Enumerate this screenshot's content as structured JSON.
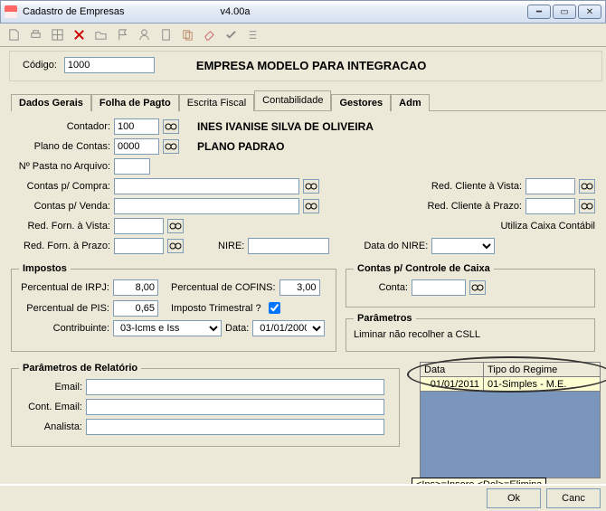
{
  "window": {
    "title": "Cadastro de Empresas",
    "version": "v4.00a"
  },
  "codigo": {
    "label": "Código:",
    "value": "1000"
  },
  "empresa_nome": "EMPRESA MODELO PARA INTEGRACAO",
  "tabs": {
    "t0": "Dados Gerais",
    "t1": "Folha de Pagto",
    "t2": "Escrita Fiscal",
    "t3": "Contabilidade",
    "t4": "Gestores",
    "t5": "Adm"
  },
  "contador": {
    "label": "Contador:",
    "value": "100",
    "display": "INES IVANISE SILVA DE OLIVEIRA"
  },
  "plano": {
    "label": "Plano de Contas:",
    "value": "0000",
    "display": "PLANO PADRAO"
  },
  "pasta": {
    "label": "Nº Pasta no Arquivo:",
    "value": ""
  },
  "contas_compra": {
    "label": "Contas p/ Compra:",
    "value": ""
  },
  "contas_venda": {
    "label": "Contas p/ Venda:",
    "value": ""
  },
  "red_forn_vista": {
    "label": "Red. Forn. à Vista:",
    "value": ""
  },
  "red_forn_prazo": {
    "label": "Red. Forn. à Prazo:",
    "value": ""
  },
  "red_cli_vista": {
    "label": "Red. Cliente à Vista:",
    "value": ""
  },
  "red_cli_prazo": {
    "label": "Red. Cliente à Prazo:",
    "value": ""
  },
  "nire": {
    "label": "NIRE:",
    "value": ""
  },
  "data_nire": {
    "label": "Data do NIRE:",
    "value": ""
  },
  "utiliza_caixa": "Utiliza Caixa Contábil",
  "impostos": {
    "legend": "Impostos",
    "irpj": {
      "label": "Percentual de IRPJ:",
      "value": "8,00"
    },
    "pis": {
      "label": "Percentual de PIS:",
      "value": "0,65"
    },
    "cofins": {
      "label": "Percentual de COFINS:",
      "value": "3,00"
    },
    "trimestral": {
      "label": "Imposto Trimestral ?",
      "checked": true
    },
    "contribuinte": {
      "label": "Contribuinte:",
      "value": "03-Icms e Iss"
    },
    "data": {
      "label": "Data:",
      "value": "01/01/2000"
    }
  },
  "contas_caixa": {
    "legend": "Contas p/ Controle de Caixa",
    "conta": {
      "label": "Conta:",
      "value": ""
    }
  },
  "parametros": {
    "legend": "Parâmetros",
    "liminar": "Liminar não recolher a CSLL"
  },
  "relatorio": {
    "legend": "Parâmetros de Relatório",
    "email": {
      "label": "Email:",
      "value": ""
    },
    "cont_email": {
      "label": "Cont. Email:",
      "value": ""
    },
    "analista": {
      "label": "Analista:",
      "value": ""
    }
  },
  "regime": {
    "col_data": "Data",
    "col_tipo": "Tipo do Regime",
    "row_data": "01/01/2011",
    "row_tipo": "01-Simples - M.E."
  },
  "hint": "<Ins>=Insere <Del>=Elimina",
  "buttons": {
    "ok": "Ok",
    "cancel": "Canc"
  }
}
